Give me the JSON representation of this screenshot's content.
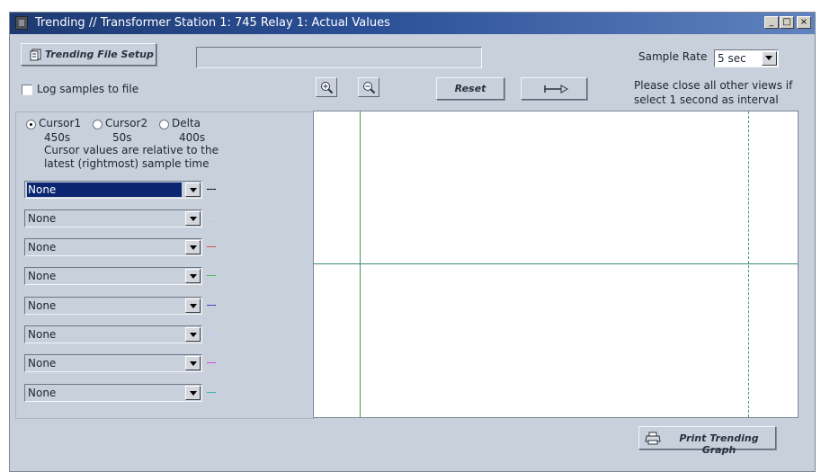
{
  "window": {
    "title": "Trending // Transformer Station 1: 745 Relay 1: Actual Values",
    "minimize": "_",
    "maximize": "□",
    "close": "×"
  },
  "toolbar": {
    "setup_button": "Trending File Setup",
    "file_path": "",
    "sample_rate_label": "Sample Rate",
    "sample_rate_value": "5 sec",
    "log_label": "Log samples to file",
    "reset_button": "Reset",
    "note_line1": "Please close all other views if",
    "note_line2": "select 1 second as interval"
  },
  "cursors": {
    "options": [
      "Cursor1",
      "Cursor2",
      "Delta"
    ],
    "selected": "Cursor1",
    "values": [
      "450s",
      "50s",
      "400s"
    ],
    "note_line1": "Cursor values are relative to the",
    "note_line2": "latest (rightmost) sample time"
  },
  "channels": [
    {
      "value": "None",
      "color": "#000000"
    },
    {
      "value": "None",
      "color": "#d8d8d8"
    },
    {
      "value": "None",
      "color": "#e04040"
    },
    {
      "value": "None",
      "color": "#30c030"
    },
    {
      "value": "None",
      "color": "#3030c0"
    },
    {
      "value": "None",
      "color": "#c8c8ff"
    },
    {
      "value": "None",
      "color": "#d040d0"
    },
    {
      "value": "None",
      "color": "#30b0b0"
    }
  ],
  "print_button": "Print Trending Graph",
  "icons": [
    "app-icon",
    "trending-file-icon",
    "zoom-in-icon",
    "zoom-out-icon",
    "arrow-right-icon",
    "printer-icon"
  ]
}
